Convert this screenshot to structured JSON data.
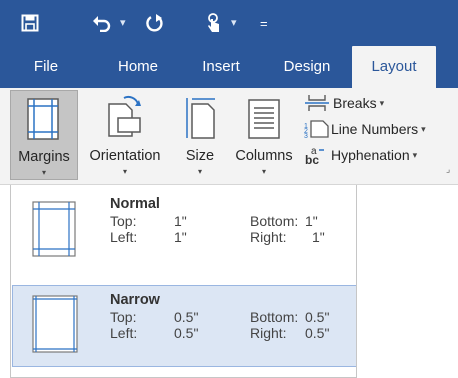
{
  "quick_access": {
    "save_icon": "save-icon",
    "undo_icon": "undo-icon",
    "redo_icon": "redo-icon",
    "touch_mode_icon": "touch-mode-icon",
    "customize_icon": "customize-qat-icon",
    "caret": "▾",
    "customize_glyph": "="
  },
  "tabs": {
    "file": "File",
    "home": "Home",
    "insert": "Insert",
    "design": "Design",
    "layout": "Layout",
    "active": "Layout"
  },
  "ribbon": {
    "margins": "Margins",
    "orientation": "Orientation",
    "size": "Size",
    "columns": "Columns",
    "breaks": "Breaks",
    "line_numbers": "Line Numbers",
    "hyphenation": "Hyphenation",
    "caret": "▾"
  },
  "margins_menu": {
    "options": [
      {
        "name": "Normal",
        "top_label": "Top:",
        "top_value": "1\"",
        "bottom_label": "Bottom:",
        "bottom_value": "1\"",
        "left_label": "Left:",
        "left_value": "1\"",
        "right_label": "Right:",
        "right_value": "1\""
      },
      {
        "name": "Narrow",
        "top_label": "Top:",
        "top_value": "0.5\"",
        "bottom_label": "Bottom:",
        "bottom_value": "0.5\"",
        "left_label": "Left:",
        "left_value": "0.5\"",
        "right_label": "Right:",
        "right_value": "0.5\""
      }
    ],
    "selected": "Narrow"
  },
  "colors": {
    "title_bar": "#2b579a",
    "ribbon_bg": "#f3f3f3",
    "selected_bg": "#dce6f4",
    "selected_border": "#9ab6e1"
  }
}
